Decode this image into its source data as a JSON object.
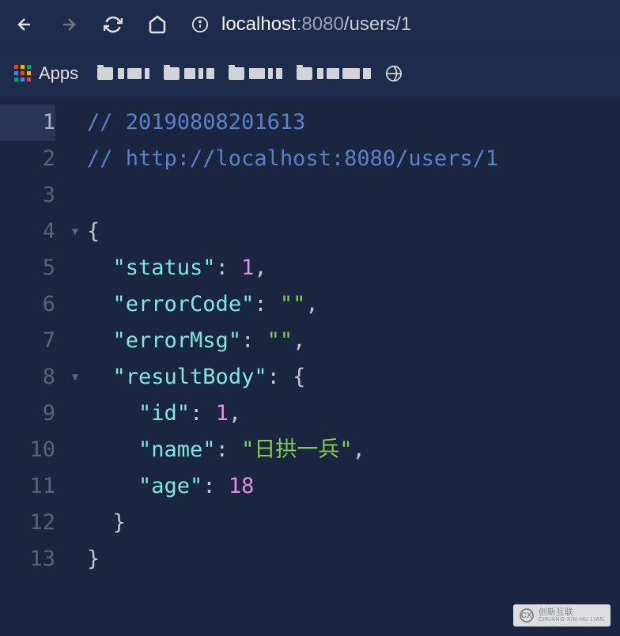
{
  "browser": {
    "url_host": "localhost",
    "url_port": ":8080",
    "url_path": "/users/1",
    "apps_label": "Apps"
  },
  "code": {
    "comment1": "// 20190808201613",
    "comment2": "// http://localhost:8080/users/1",
    "json": {
      "status_key": "\"status\"",
      "status_val": "1",
      "errorCode_key": "\"errorCode\"",
      "errorCode_val": "\"\"",
      "errorMsg_key": "\"errorMsg\"",
      "errorMsg_val": "\"\"",
      "resultBody_key": "\"resultBody\"",
      "id_key": "\"id\"",
      "id_val": "1",
      "name_key": "\"name\"",
      "name_val": "\"日拱一兵\"",
      "age_key": "\"age\"",
      "age_val": "18"
    }
  },
  "watermark": {
    "brand": "创新互联",
    "url": "CHUANG-XIN-HU LIAN"
  },
  "lines": [
    "1",
    "2",
    "3",
    "4",
    "5",
    "6",
    "7",
    "8",
    "9",
    "10",
    "11",
    "12",
    "13"
  ]
}
